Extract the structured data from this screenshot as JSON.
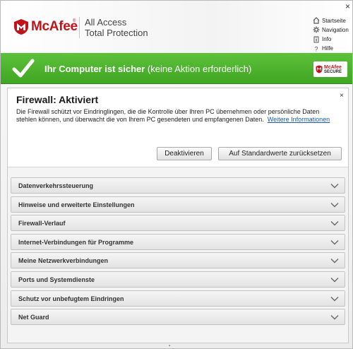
{
  "header": {
    "brand": "McAfee",
    "product_line1": "All Access",
    "product_line2": "Total Protection",
    "close_glyph": "×"
  },
  "nav": [
    {
      "label": "Startseite",
      "icon": "home-icon"
    },
    {
      "label": "Navigation",
      "icon": "gear-icon"
    },
    {
      "label": "Info",
      "icon": "info-icon"
    },
    {
      "label": "Hilfe",
      "icon": "help-icon"
    }
  ],
  "status": {
    "bold": "Ihr Computer ist sicher",
    "rest": " (keine Aktion erforderlich)",
    "badge_line1": "McAfee",
    "badge_line2": "SECURE",
    "color": "#4cb52e"
  },
  "firewall": {
    "title": "Firewall: Aktiviert",
    "description": "Die Firewall schützt vor Eindringlingen, die die Kontrolle über Ihren PC übernehmen oder persönliche Daten stehlen können, und überwacht die von Ihrem PC gesendeten und empfangenen Daten.",
    "link": "Weitere Informationen",
    "close_glyph": "×",
    "btn_deactivate": "Deaktivieren",
    "btn_defaults": "Auf Standardwerte zurücksetzen"
  },
  "sections": [
    "Datenverkehrssteuerung",
    "Hinweise und erweiterte Einstellungen",
    "Firewall-Verlauf",
    "Internet-Verbindungen für Programme",
    "Meine Netzwerkverbindungen",
    "Ports und Systemdienste",
    "Schutz vor unbefugtem Eindringen",
    "Net Guard"
  ],
  "grip": "''''''''''"
}
